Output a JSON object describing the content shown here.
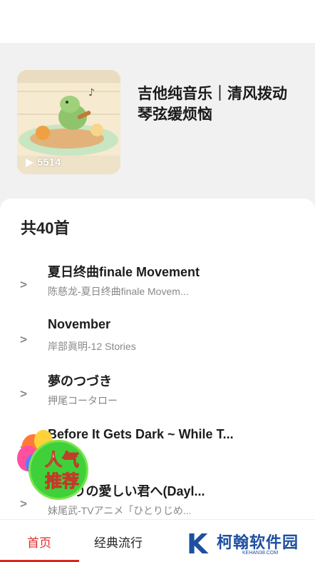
{
  "playlist": {
    "title": "吉他纯音乐｜清风拨动琴弦缓烦恼",
    "play_count": "5514"
  },
  "song_list": {
    "count_label": "共40首",
    "arrow_glyph": ">",
    "songs": [
      {
        "name": "夏日终曲finale Movement",
        "artist": "陈慈龙-夏日终曲finale Movem..."
      },
      {
        "name": "November",
        "artist": "岸部眞明-12 Stories"
      },
      {
        "name": "夢のつづき",
        "artist": "押尾コータロー"
      },
      {
        "name": "Before It Gets Dark ~ While T...",
        "artist": ""
      },
      {
        "name": "ひとりの愛しい君へ(Dayl...",
        "artist": "妹尾武-TVアニメ「ひとりじめ..."
      }
    ]
  },
  "badge": {
    "line1": "人气",
    "line2": "推荐"
  },
  "tabs": [
    {
      "label": "首页",
      "active": true
    },
    {
      "label": "经典流行",
      "active": false
    }
  ],
  "watermark": {
    "logo_letter": "K",
    "name": "柯翰软件园",
    "url": "KEHAN38.COM"
  },
  "colors": {
    "accent_red": "#e12d2d",
    "badge_green": "#3fd13a",
    "watermark_blue": "#1e4fa0"
  }
}
